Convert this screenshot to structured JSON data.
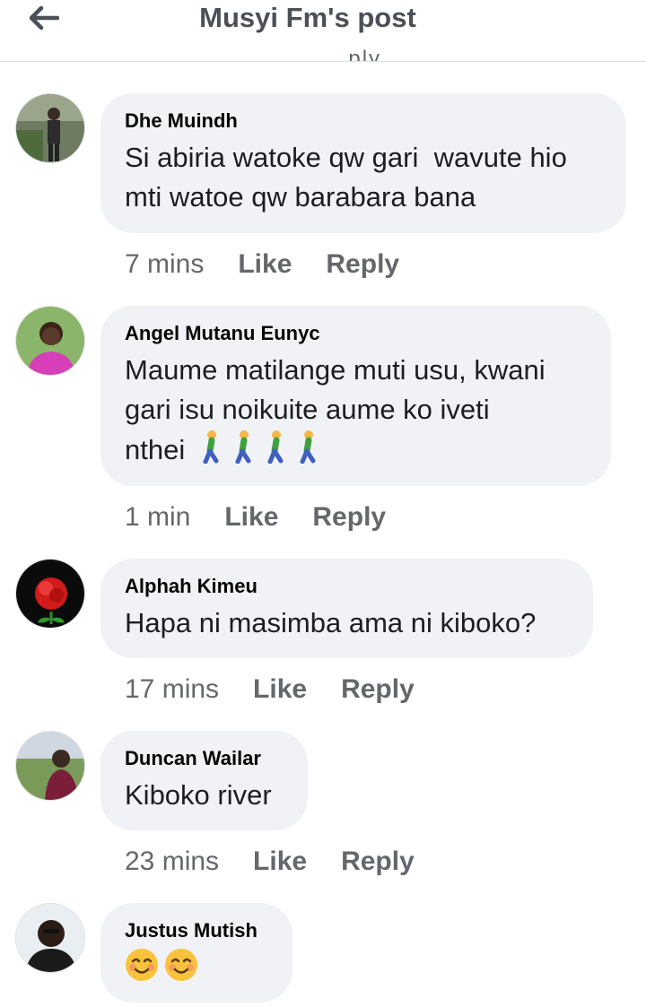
{
  "header": {
    "title": "Musyi Fm's post",
    "back_icon": "arrow-left-icon",
    "cut_off_text": "... . . . . . . . . ply"
  },
  "colors": {
    "bubble_bg": "#f0f2f5",
    "action_text": "#65676b",
    "title_text": "#4b4f56"
  },
  "comments": [
    {
      "author": "Dhe Muindh",
      "text_line1": "Si abiria watoke qw gari  wavute hio",
      "text_line2": "mti watoe qw barabara bana",
      "time": "7 mins",
      "like": "Like",
      "reply": "Reply"
    },
    {
      "author": "Angel Mutanu Eunyc",
      "text_line1": "Maume matilange muti usu, kwani",
      "text_line2": "gari isu noikuite aume ko iveti",
      "text_line3": "nthei",
      "emoji": "man-walking-emoji x4",
      "time": "1 min",
      "like": "Like",
      "reply": "Reply"
    },
    {
      "author": "Alphah Kimeu",
      "text_line1": "Hapa ni masimba ama ni kiboko?",
      "time": "17 mins",
      "like": "Like",
      "reply": "Reply"
    },
    {
      "author": "Duncan Wailar",
      "text_line1": "Kiboko river",
      "time": "23 mins",
      "like": "Like",
      "reply": "Reply"
    },
    {
      "author": "Justus Mutish",
      "emoji": "smiling-face-emoji x2"
    }
  ]
}
